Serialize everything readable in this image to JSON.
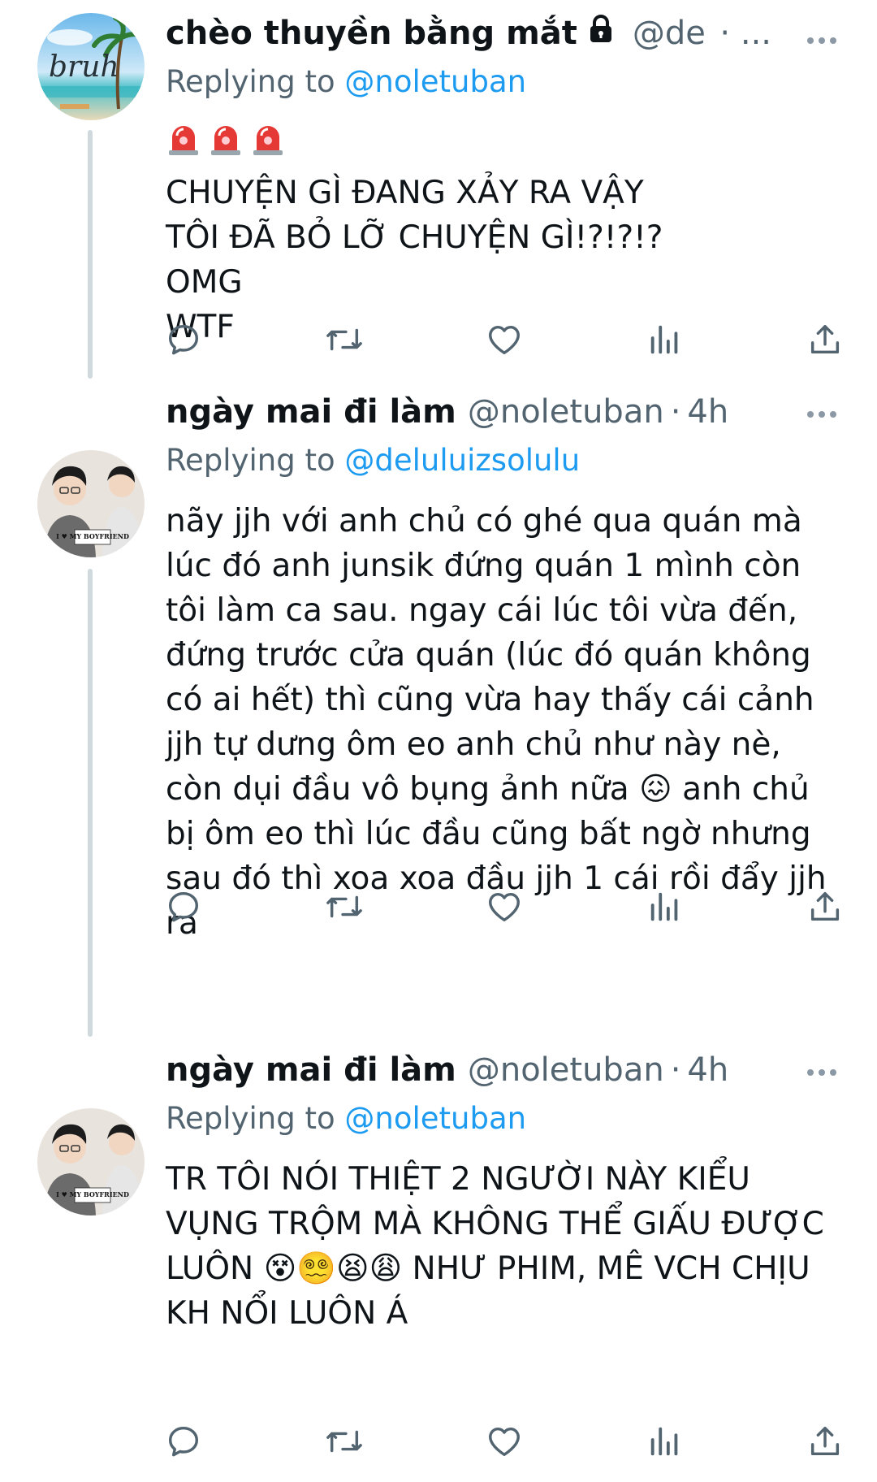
{
  "colors": {
    "text": "#0f1419",
    "secondary": "#536471",
    "link": "#1d9bf0",
    "thread_line": "#cfd9de"
  },
  "tweets": [
    {
      "display_name": "chèo thuyền bằng mắt",
      "handle": "@de...",
      "time": "· ...",
      "protected": true,
      "avatar_text": "bruh",
      "replying_prefix": "Replying to",
      "replying_to": "@noletuban",
      "emoji_prefix": [
        "rotating-light",
        "rotating-light",
        "rotating-light"
      ],
      "text": "CHUYỆN GÌ ĐANG XẢY RA VẬY\nTÔI ĐÃ BỎ LỠ CHUYỆN GÌ!?!?!?\nOMG\nWTF"
    },
    {
      "display_name": "ngày mai đi làm",
      "handle": "@noletuban",
      "time": "4h",
      "protected": false,
      "avatar_badge": "I ♥ MY BOYFRIEND",
      "replying_prefix": "Replying to",
      "replying_to": "@deluluizsolulu",
      "text_parts": {
        "before_emoji": "nãy jjh với anh chủ có ghé qua quán mà lúc đó anh junsik đứng quán 1 mình còn tôi làm ca sau. ngay cái lúc tôi vừa đến, đứng trước cửa quán (lúc đó quán không có ai hết) thì cũng vừa hay thấy cái cảnh jjh tự dưng ôm eo anh chủ như này nè, còn dụi đầu vô bụng ảnh nữa ",
        "emoji": "😖",
        "after_emoji": " anh chủ bị ôm eo thì lúc đầu cũng bất ngờ nhưng sau đó thì xoa xoa đầu jjh 1 cái rồi đẩy jjh ra"
      }
    },
    {
      "display_name": "ngày mai đi làm",
      "handle": "@noletuban",
      "time": "4h",
      "protected": false,
      "avatar_badge": "I ♥ MY BOYFRIEND",
      "replying_prefix": "Replying to",
      "replying_to": "@noletuban",
      "text_parts": {
        "before_emoji": "TR TÔI NÓI THIỆT 2 NGƯỜI NÀY KIỂU VỤNG TRỘM MÀ KHÔNG THỂ GIẤU ĐƯỢC LUÔN ",
        "emoji": "😵😵‍💫😫😩",
        "after_emoji": " NHƯ PHIM, MÊ VCH CHỊU KH NỔI LUÔN Á"
      }
    }
  ],
  "action_icons": [
    "reply-icon",
    "retweet-icon",
    "like-icon",
    "views-icon",
    "share-icon"
  ]
}
